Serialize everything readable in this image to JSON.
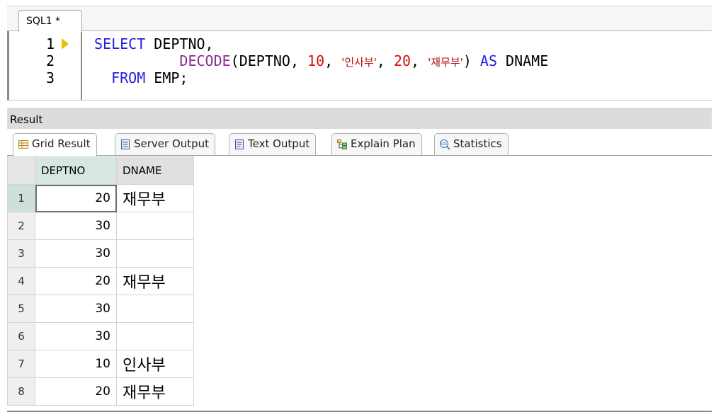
{
  "editor": {
    "tab_label": "SQL1 *",
    "line_numbers": [
      "1",
      "2",
      "3"
    ],
    "lines": [
      [
        {
          "t": "SELECT",
          "c": "kw-blue"
        },
        {
          "t": " DEPTNO,",
          "c": ""
        }
      ],
      [
        {
          "t": "          ",
          "c": ""
        },
        {
          "t": "DECODE",
          "c": "kw-purple"
        },
        {
          "t": "(DEPTNO, ",
          "c": ""
        },
        {
          "t": "10",
          "c": "num"
        },
        {
          "t": ", ",
          "c": ""
        },
        {
          "t": "'인사부'",
          "c": "str"
        },
        {
          "t": ", ",
          "c": ""
        },
        {
          "t": "20",
          "c": "num"
        },
        {
          "t": ", ",
          "c": ""
        },
        {
          "t": "'재무부'",
          "c": "str"
        },
        {
          "t": ") ",
          "c": ""
        },
        {
          "t": "AS",
          "c": "kw-blue"
        },
        {
          "t": " DNAME",
          "c": ""
        }
      ],
      [
        {
          "t": "  ",
          "c": ""
        },
        {
          "t": "FROM",
          "c": "kw-blue"
        },
        {
          "t": " EMP;",
          "c": ""
        }
      ]
    ]
  },
  "result": {
    "title": "Result",
    "tabs": [
      {
        "label": "Grid Result",
        "icon": "grid-result-icon",
        "active": true
      },
      {
        "label": "Server Output",
        "icon": "server-output-icon",
        "active": false
      },
      {
        "label": "Text Output",
        "icon": "text-output-icon",
        "active": false
      },
      {
        "label": "Explain Plan",
        "icon": "explain-plan-icon",
        "active": false
      },
      {
        "label": "Statistics",
        "icon": "statistics-icon",
        "active": false
      }
    ],
    "grid": {
      "columns": [
        "DEPTNO",
        "DNAME"
      ],
      "rows": [
        {
          "n": "1",
          "deptno": "20",
          "dname": "재무부"
        },
        {
          "n": "2",
          "deptno": "30",
          "dname": ""
        },
        {
          "n": "3",
          "deptno": "30",
          "dname": ""
        },
        {
          "n": "4",
          "deptno": "20",
          "dname": "재무부"
        },
        {
          "n": "5",
          "deptno": "30",
          "dname": ""
        },
        {
          "n": "6",
          "deptno": "30",
          "dname": ""
        },
        {
          "n": "7",
          "deptno": "10",
          "dname": "인사부"
        },
        {
          "n": "8",
          "deptno": "20",
          "dname": "재무부"
        }
      ],
      "selected_row": "1"
    }
  },
  "colors": {
    "keyword": "#2424d8",
    "function": "#8a2c8f",
    "number": "#d80f0f",
    "string": "#b40c0c",
    "current_line_marker": "#e9c300"
  }
}
